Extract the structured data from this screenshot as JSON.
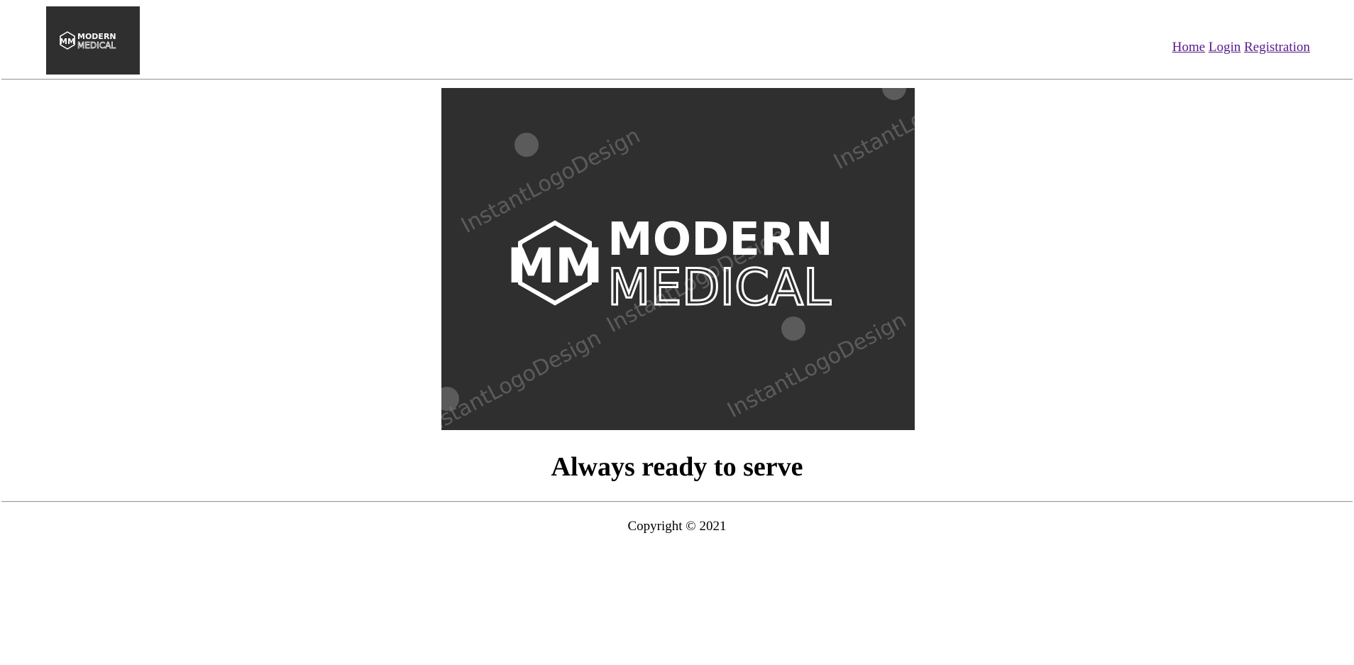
{
  "header": {
    "logo": {
      "name": "modern-medical-logo",
      "monogram": "MM",
      "line1": "MODERN",
      "line2": "MEDICAL"
    },
    "nav": [
      {
        "label": "Home"
      },
      {
        "label": "Login"
      },
      {
        "label": "Registration"
      }
    ],
    "link_color": "#551a8b"
  },
  "hero": {
    "logo": {
      "monogram": "MM",
      "line1": "MODERN",
      "line2": "MEDICAL"
    },
    "watermark": "InstantLogoDesign",
    "background": "#2f2f2f"
  },
  "main": {
    "tagline": "Always ready to serve"
  },
  "footer": {
    "copyright": "Copyright © 2021"
  }
}
